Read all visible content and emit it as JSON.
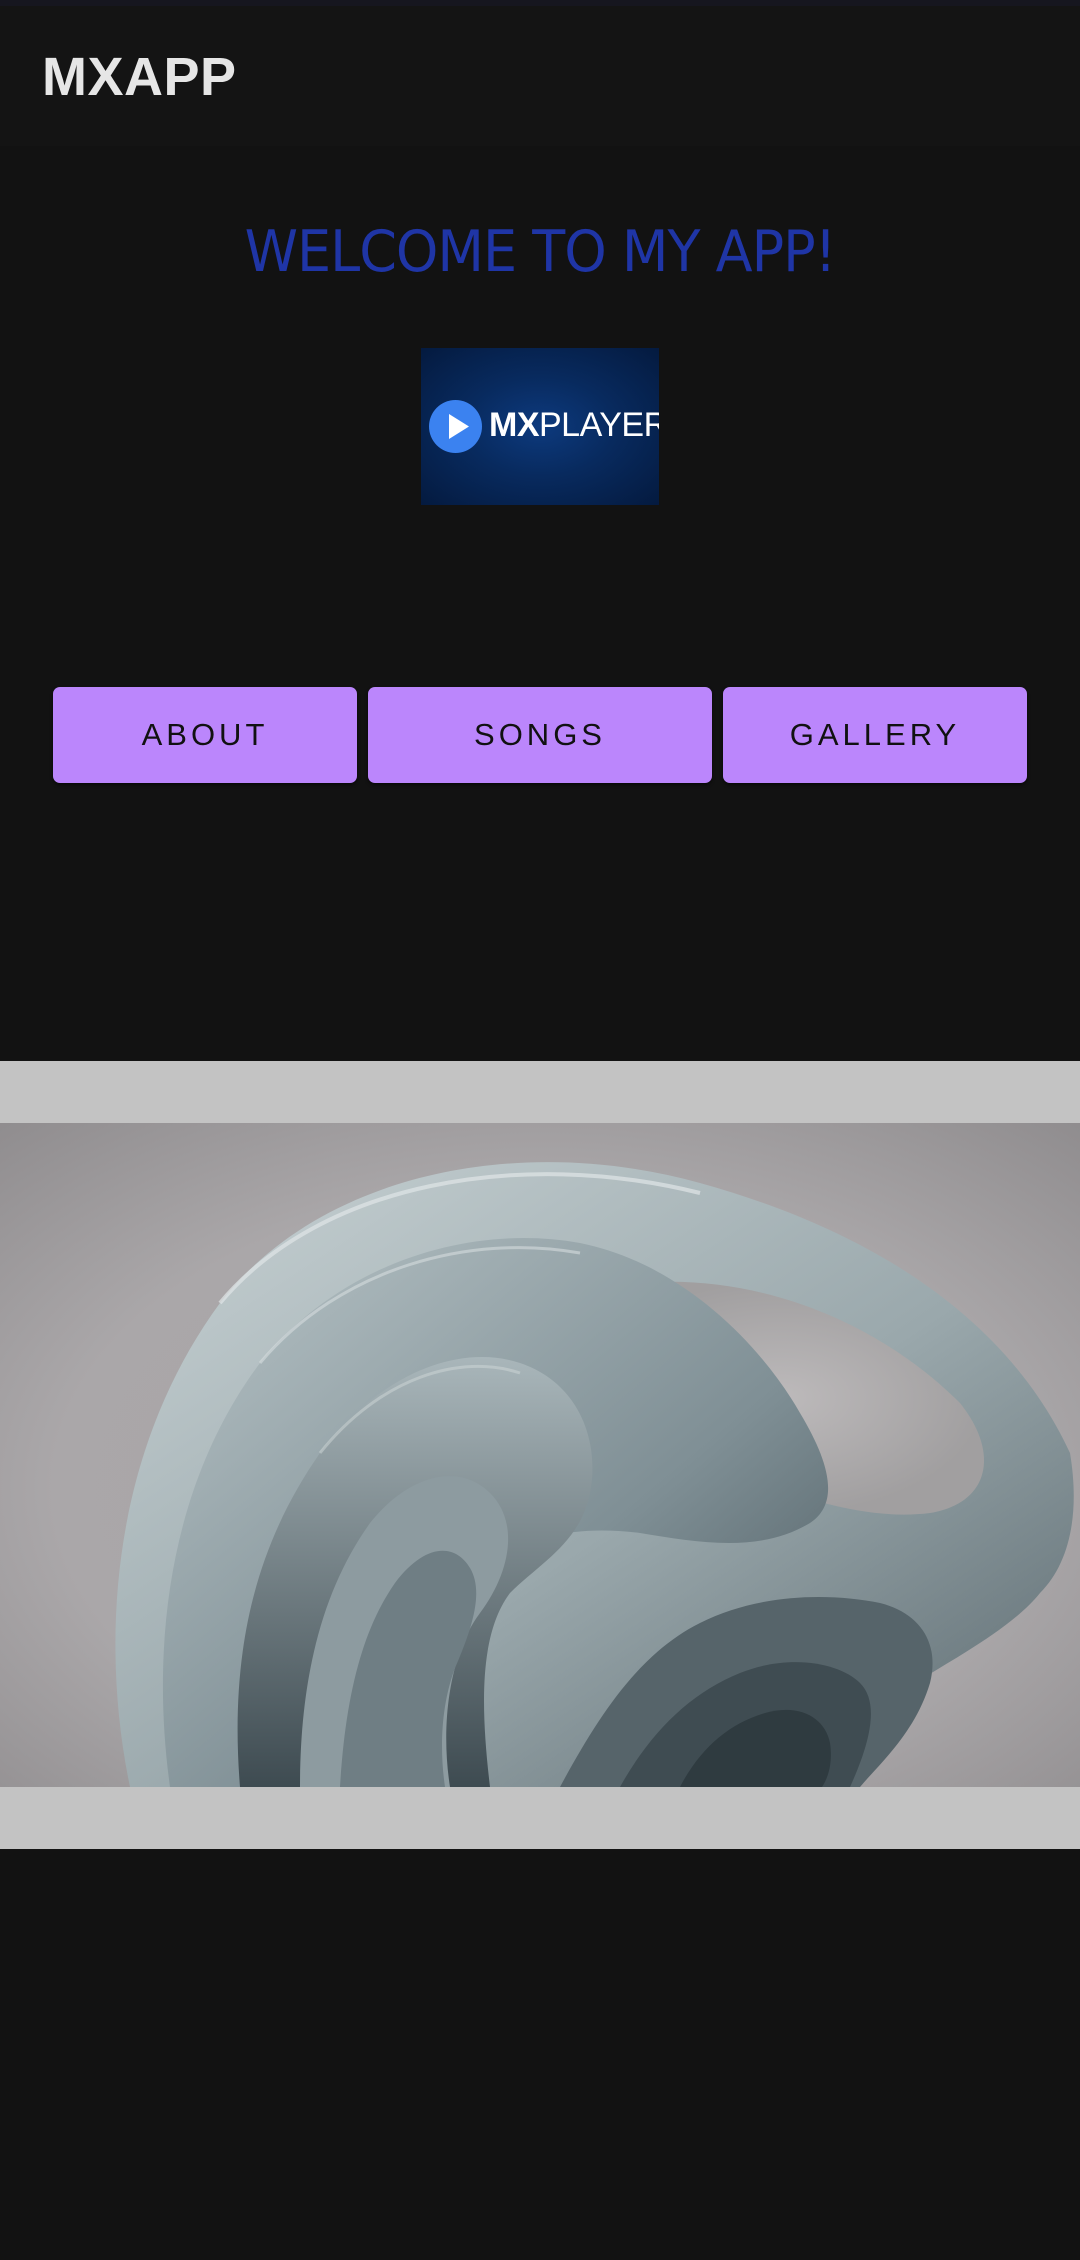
{
  "app_bar": {
    "title": "MXAPP"
  },
  "main": {
    "welcome": "WELCOME TO MY APP!",
    "logo": {
      "icon": "play-icon",
      "brand_bold": "MX",
      "brand_light": "PLAYER"
    },
    "buttons": {
      "about": "ABOUT",
      "songs": "SONGS",
      "gallery": "GALLERY"
    },
    "image": {
      "description_icon": "abstract-wallpaper"
    }
  },
  "colors": {
    "background": "#121212",
    "accent_button": "#bb86fc",
    "welcome_text": "#1f35a6",
    "logo_blue": "#3b82f0",
    "image_frame": "#c3c3c3"
  }
}
